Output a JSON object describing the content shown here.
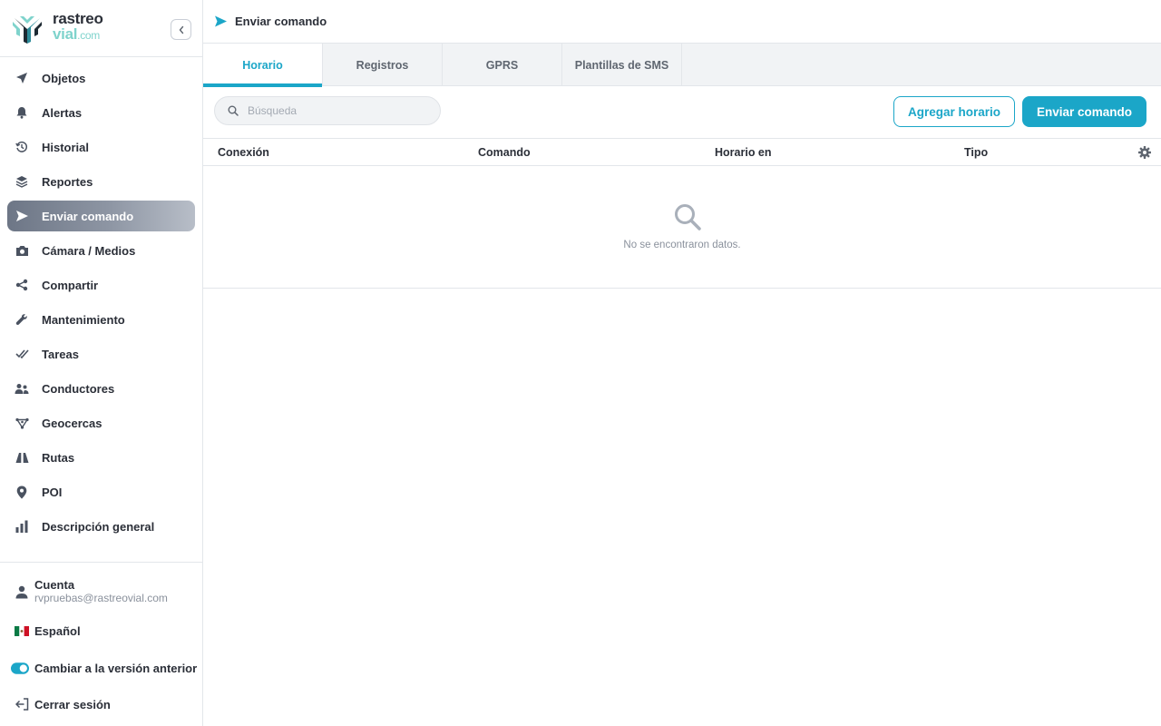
{
  "brand": {
    "line1": "rastreo",
    "line2": "vial",
    "line2_suffix": ".com",
    "accent": "#1ba6c8"
  },
  "sidebar": {
    "items": [
      {
        "label": "Objetos",
        "icon": "location-arrow-icon"
      },
      {
        "label": "Alertas",
        "icon": "bell-icon"
      },
      {
        "label": "Historial",
        "icon": "history-icon"
      },
      {
        "label": "Reportes",
        "icon": "layers-icon"
      },
      {
        "label": "Enviar comando",
        "icon": "send-icon",
        "active": true
      },
      {
        "label": "Cámara / Medios",
        "icon": "camera-icon"
      },
      {
        "label": "Compartir",
        "icon": "share-icon"
      },
      {
        "label": "Mantenimiento",
        "icon": "wrench-icon"
      },
      {
        "label": "Tareas",
        "icon": "double-check-icon"
      },
      {
        "label": "Conductores",
        "icon": "users-icon"
      },
      {
        "label": "Geocercas",
        "icon": "geofence-icon"
      },
      {
        "label": "Rutas",
        "icon": "road-icon"
      },
      {
        "label": "POI",
        "icon": "map-pin-icon"
      },
      {
        "label": "Descripción general",
        "icon": "bar-chart-icon"
      }
    ],
    "account": {
      "label": "Cuenta",
      "email": "rvpruebas@rastreovial.com"
    },
    "language": {
      "label": "Español"
    },
    "toggle": {
      "label": "Cambiar a la versión anterior",
      "on": true
    },
    "logout": {
      "label": "Cerrar sesión"
    }
  },
  "header": {
    "title": "Enviar comando"
  },
  "tabs": [
    {
      "label": "Horario",
      "active": true
    },
    {
      "label": "Registros"
    },
    {
      "label": "GPRS"
    },
    {
      "label": "Plantillas de SMS"
    }
  ],
  "toolbar": {
    "search_placeholder": "Búsqueda",
    "add_schedule_label": "Agregar horario",
    "send_command_label": "Enviar comando"
  },
  "table": {
    "columns": [
      "Conexión",
      "Comando",
      "Horario en",
      "Tipo"
    ],
    "empty_message": "No se encontraron datos."
  }
}
